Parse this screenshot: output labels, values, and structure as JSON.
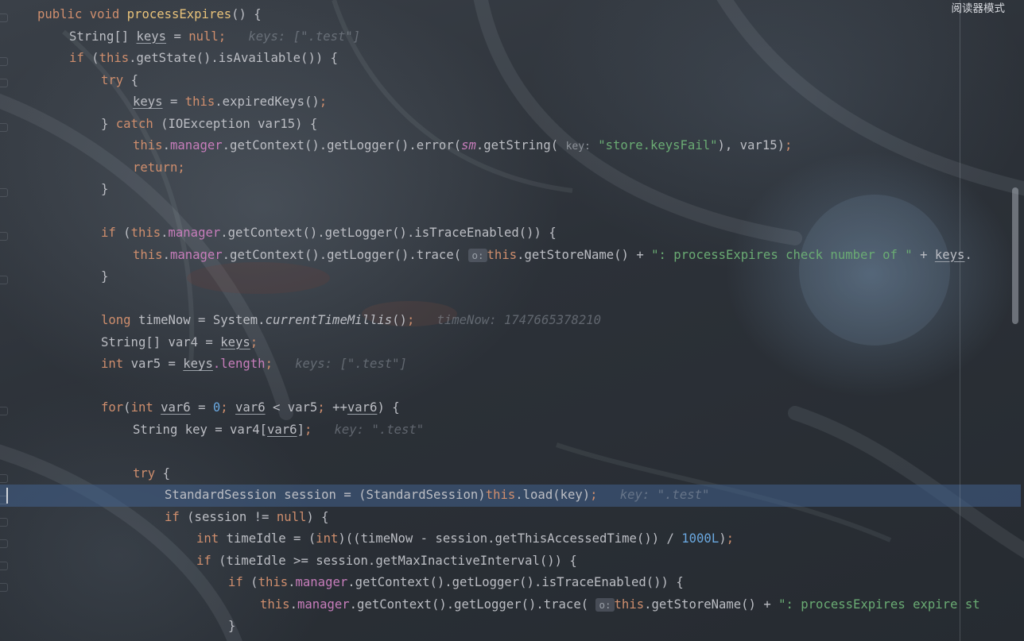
{
  "reader_mode_label": "阅读器模式",
  "code_lines": [
    {
      "indent": 0,
      "tokens": [
        {
          "t": "public void ",
          "c": "kw"
        },
        {
          "t": "processExpires",
          "c": "fn"
        },
        {
          "t": "() {",
          "c": ""
        }
      ]
    },
    {
      "indent": 1,
      "tokens": [
        {
          "t": "String[] ",
          "c": ""
        },
        {
          "t": "keys",
          "c": "ul"
        },
        {
          "t": " = ",
          "c": ""
        },
        {
          "t": "null",
          "c": "kw"
        },
        {
          "t": ";",
          "c": "kw"
        },
        {
          "t": "   keys: [\".test\"]",
          "c": "hint"
        }
      ]
    },
    {
      "indent": 1,
      "tokens": [
        {
          "t": "if ",
          "c": "kw"
        },
        {
          "t": "(",
          "c": ""
        },
        {
          "t": "this",
          "c": "kw"
        },
        {
          "t": ".getState().isAvailable()) {",
          "c": ""
        }
      ]
    },
    {
      "indent": 2,
      "tokens": [
        {
          "t": "try ",
          "c": "kw"
        },
        {
          "t": "{",
          "c": ""
        }
      ]
    },
    {
      "indent": 3,
      "tokens": [
        {
          "t": "keys",
          "c": "ul"
        },
        {
          "t": " = ",
          "c": ""
        },
        {
          "t": "this",
          "c": "kw"
        },
        {
          "t": ".expiredKeys()",
          "c": ""
        },
        {
          "t": ";",
          "c": "kw"
        }
      ]
    },
    {
      "indent": 2,
      "tokens": [
        {
          "t": "} ",
          "c": ""
        },
        {
          "t": "catch ",
          "c": "kw"
        },
        {
          "t": "(IOException var15) {",
          "c": ""
        }
      ]
    },
    {
      "indent": 3,
      "tokens": [
        {
          "t": "this",
          "c": "kw"
        },
        {
          "t": ".",
          "c": ""
        },
        {
          "t": "manager",
          "c": "fld"
        },
        {
          "t": ".getContext().getLogger().error(",
          "c": ""
        },
        {
          "t": "sm",
          "c": "stat"
        },
        {
          "t": ".getString( ",
          "c": ""
        },
        {
          "t": "key:",
          "c": "pn"
        },
        {
          "t": " ",
          "c": ""
        },
        {
          "t": "\"store.keysFail\"",
          "c": "str"
        },
        {
          "t": "), var15)",
          "c": ""
        },
        {
          "t": ";",
          "c": "kw"
        }
      ]
    },
    {
      "indent": 3,
      "tokens": [
        {
          "t": "return",
          "c": "kw"
        },
        {
          "t": ";",
          "c": "kw"
        }
      ]
    },
    {
      "indent": 2,
      "tokens": [
        {
          "t": "}",
          "c": ""
        }
      ]
    },
    {
      "indent": 0,
      "tokens": []
    },
    {
      "indent": 2,
      "tokens": [
        {
          "t": "if ",
          "c": "kw"
        },
        {
          "t": "(",
          "c": ""
        },
        {
          "t": "this",
          "c": "kw"
        },
        {
          "t": ".",
          "c": ""
        },
        {
          "t": "manager",
          "c": "fld"
        },
        {
          "t": ".getContext().getLogger().isTraceEnabled()) {",
          "c": ""
        }
      ]
    },
    {
      "indent": 3,
      "tokens": [
        {
          "t": "this",
          "c": "kw"
        },
        {
          "t": ".",
          "c": ""
        },
        {
          "t": "manager",
          "c": "fld"
        },
        {
          "t": ".getContext().getLogger().trace( ",
          "c": ""
        },
        {
          "t": "o:",
          "c": "chip"
        },
        {
          "t": "this",
          "c": "kw"
        },
        {
          "t": ".getStoreName() + ",
          "c": ""
        },
        {
          "t": "\": processExpires check number of \"",
          "c": "str"
        },
        {
          "t": " + ",
          "c": ""
        },
        {
          "t": "keys",
          "c": "ul"
        },
        {
          "t": ".",
          "c": ""
        }
      ]
    },
    {
      "indent": 2,
      "tokens": [
        {
          "t": "}",
          "c": ""
        }
      ]
    },
    {
      "indent": 0,
      "tokens": []
    },
    {
      "indent": 2,
      "tokens": [
        {
          "t": "long ",
          "c": "kw"
        },
        {
          "t": "timeNow = System.",
          "c": ""
        },
        {
          "t": "currentTimeMillis",
          "c": "smi"
        },
        {
          "t": "()",
          "c": ""
        },
        {
          "t": ";",
          "c": "kw"
        },
        {
          "t": "   timeNow: 1747665378210",
          "c": "hint"
        }
      ]
    },
    {
      "indent": 2,
      "tokens": [
        {
          "t": "String[] var4 = ",
          "c": ""
        },
        {
          "t": "keys",
          "c": "ul"
        },
        {
          "t": ";",
          "c": "kw"
        }
      ]
    },
    {
      "indent": 2,
      "tokens": [
        {
          "t": "int ",
          "c": "kw"
        },
        {
          "t": "var5 = ",
          "c": ""
        },
        {
          "t": "keys",
          "c": "ul"
        },
        {
          "t": ".length",
          "c": "fld"
        },
        {
          "t": ";",
          "c": "kw"
        },
        {
          "t": "   keys: [\".test\"]",
          "c": "hint"
        }
      ]
    },
    {
      "indent": 0,
      "tokens": []
    },
    {
      "indent": 2,
      "tokens": [
        {
          "t": "for",
          "c": "kw"
        },
        {
          "t": "(",
          "c": ""
        },
        {
          "t": "int ",
          "c": "kw"
        },
        {
          "t": "var6",
          "c": "ul"
        },
        {
          "t": " = ",
          "c": ""
        },
        {
          "t": "0",
          "c": "num"
        },
        {
          "t": "; ",
          "c": "kw"
        },
        {
          "t": "var6",
          "c": "ul"
        },
        {
          "t": " < var5",
          "c": ""
        },
        {
          "t": "; ",
          "c": "kw"
        },
        {
          "t": "++",
          "c": ""
        },
        {
          "t": "var6",
          "c": "ul"
        },
        {
          "t": ") {",
          "c": ""
        }
      ]
    },
    {
      "indent": 3,
      "tokens": [
        {
          "t": "String key = var4[",
          "c": ""
        },
        {
          "t": "var6",
          "c": "ul"
        },
        {
          "t": "]",
          "c": ""
        },
        {
          "t": ";",
          "c": "kw"
        },
        {
          "t": "   key: \".test\"",
          "c": "hint"
        }
      ]
    },
    {
      "indent": 0,
      "tokens": []
    },
    {
      "indent": 3,
      "tokens": [
        {
          "t": "try ",
          "c": "kw"
        },
        {
          "t": "{",
          "c": ""
        }
      ]
    },
    {
      "indent": 4,
      "current": true,
      "tokens": [
        {
          "t": "StandardSession session = (StandardSession)",
          "c": ""
        },
        {
          "t": "this",
          "c": "kw"
        },
        {
          "t": ".load(key)",
          "c": ""
        },
        {
          "t": ";",
          "c": "kw"
        },
        {
          "t": "   key: \".test\"",
          "c": "hint"
        }
      ]
    },
    {
      "indent": 4,
      "tokens": [
        {
          "t": "if ",
          "c": "kw"
        },
        {
          "t": "(session != ",
          "c": ""
        },
        {
          "t": "null",
          "c": "kw"
        },
        {
          "t": ") {",
          "c": ""
        }
      ]
    },
    {
      "indent": 5,
      "tokens": [
        {
          "t": "int ",
          "c": "kw"
        },
        {
          "t": "timeIdle = (",
          "c": ""
        },
        {
          "t": "int",
          "c": "kw"
        },
        {
          "t": ")((timeNow - session.getThisAccessedTime()) / ",
          "c": ""
        },
        {
          "t": "1000L",
          "c": "num"
        },
        {
          "t": ")",
          "c": ""
        },
        {
          "t": ";",
          "c": "kw"
        }
      ]
    },
    {
      "indent": 5,
      "tokens": [
        {
          "t": "if ",
          "c": "kw"
        },
        {
          "t": "(timeIdle >= session.getMaxInactiveInterval()) {",
          "c": ""
        }
      ]
    },
    {
      "indent": 6,
      "tokens": [
        {
          "t": "if ",
          "c": "kw"
        },
        {
          "t": "(",
          "c": ""
        },
        {
          "t": "this",
          "c": "kw"
        },
        {
          "t": ".",
          "c": ""
        },
        {
          "t": "manager",
          "c": "fld"
        },
        {
          "t": ".getContext().getLogger().isTraceEnabled()) {",
          "c": ""
        }
      ]
    },
    {
      "indent": 7,
      "tokens": [
        {
          "t": "this",
          "c": "kw"
        },
        {
          "t": ".",
          "c": ""
        },
        {
          "t": "manager",
          "c": "fld"
        },
        {
          "t": ".getContext().getLogger().trace( ",
          "c": ""
        },
        {
          "t": "o:",
          "c": "chip"
        },
        {
          "t": "this",
          "c": "kw"
        },
        {
          "t": ".getStoreName() + ",
          "c": ""
        },
        {
          "t": "\": processExpires expire st",
          "c": "str"
        }
      ]
    },
    {
      "indent": 6,
      "tokens": [
        {
          "t": "}",
          "c": ""
        }
      ]
    }
  ]
}
